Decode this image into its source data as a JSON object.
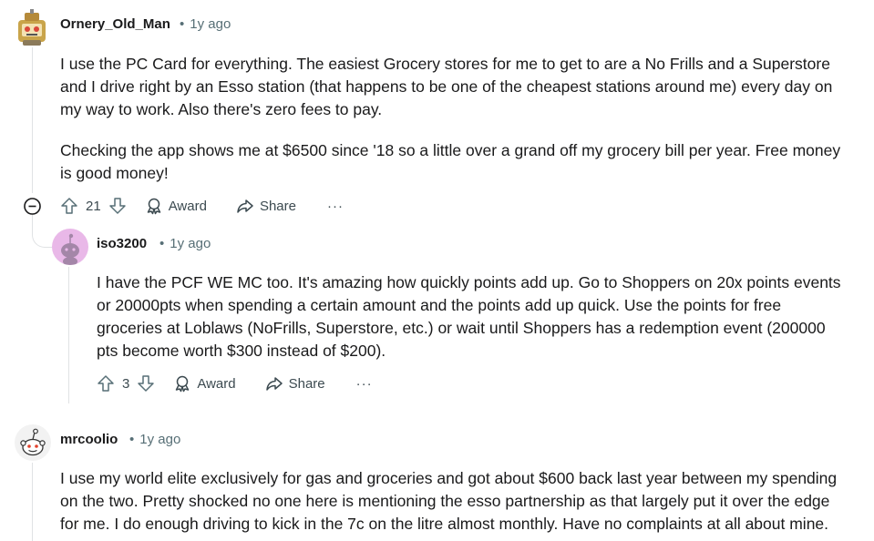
{
  "comments": [
    {
      "author": "Ornery_Old_Man",
      "age": "1y ago",
      "paragraphs": [
        "I use the PC Card for everything. The easiest Grocery stores for me to get to are a No Frills and a Superstore and I drive right by an Esso station (that happens to be one of the cheapest stations around me) every day on my way to work. Also there's zero fees to pay.",
        "Checking the app shows me at $6500 since '18 so a little over a grand off my grocery bill per year. Free money is good money!"
      ],
      "votes": "21",
      "award_label": "Award",
      "share_label": "Share",
      "more": "···"
    },
    {
      "author": "iso3200",
      "age": "1y ago",
      "paragraphs": [
        "I have the PCF WE MC too. It's amazing how quickly points add up. Go to Shoppers on 20x points events or 20000pts when spending a certain amount and the points add up quick. Use the points for free groceries at Loblaws (NoFrills, Superstore, etc.) or wait until Shoppers has a redemption event (200000 pts become worth $300 instead of $200)."
      ],
      "votes": "3",
      "award_label": "Award",
      "share_label": "Share",
      "more": "···"
    },
    {
      "author": "mrcoolio",
      "age": "1y ago",
      "paragraphs": [
        "I use my world elite exclusively for gas and groceries and got about $600 back last year between my spending on the two. Pretty shocked no one here is mentioning the esso partnership as that largely put it over the edge for me. I do enough driving to kick in the 7c on the litre almost monthly. Have no complaints at all about mine."
      ]
    }
  ],
  "dot": "•",
  "colors": {
    "meta": "#576f76",
    "thread_line": "#e0e2e4",
    "text": "#1a1a1b"
  }
}
